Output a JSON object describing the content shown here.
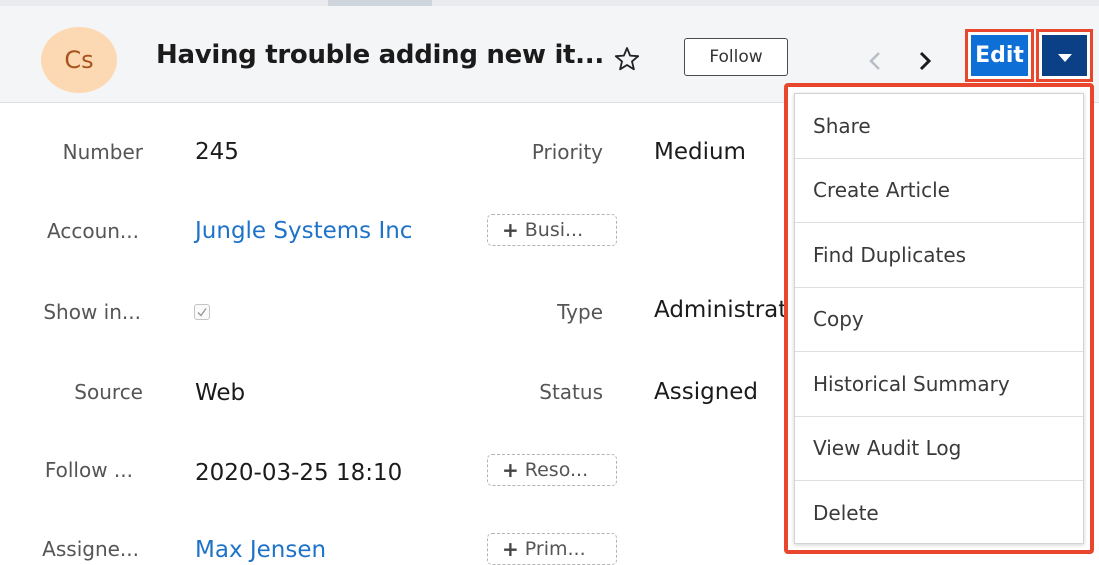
{
  "record": {
    "avatar_initials": "Cs",
    "title": "Having trouble adding new it...",
    "follow_label": "Follow"
  },
  "actions": {
    "edit_label": "Edit"
  },
  "fields": {
    "number": {
      "label": "Number",
      "value": "245"
    },
    "priority": {
      "label": "Priority",
      "value": "Medium"
    },
    "account": {
      "label": "Accoun...",
      "value": "Jungle Systems Inc"
    },
    "business_center": {
      "label": "Busi..."
    },
    "show_in": {
      "label": "Show in...",
      "checked": true
    },
    "type": {
      "label": "Type",
      "value": "Administrati"
    },
    "source": {
      "label": "Source",
      "value": "Web"
    },
    "status": {
      "label": "Status",
      "value": "Assigned"
    },
    "follow_up": {
      "label": "Follow ...",
      "value": "2020-03-25 18:10"
    },
    "resolved": {
      "label": "Reso..."
    },
    "assigned": {
      "label": "Assigne...",
      "value": "Max Jensen"
    },
    "primary": {
      "label": "Prim..."
    }
  },
  "menu": {
    "items": [
      "Share",
      "Create Article",
      "Find Duplicates",
      "Copy",
      "Historical Summary",
      "View Audit Log",
      "Delete"
    ]
  },
  "colors": {
    "primary_blue": "#0e6fd6",
    "dark_blue": "#0b3f86",
    "highlight_red": "#e8472d",
    "link_blue": "#1e73c9",
    "avatar_bg": "#fcd8b3"
  },
  "icons": {
    "star": "star-outline-icon",
    "prev": "chevron-left-icon",
    "next": "chevron-right-icon",
    "caret": "caret-down-icon",
    "plus": "plus-icon",
    "check": "checkmark-icon"
  }
}
